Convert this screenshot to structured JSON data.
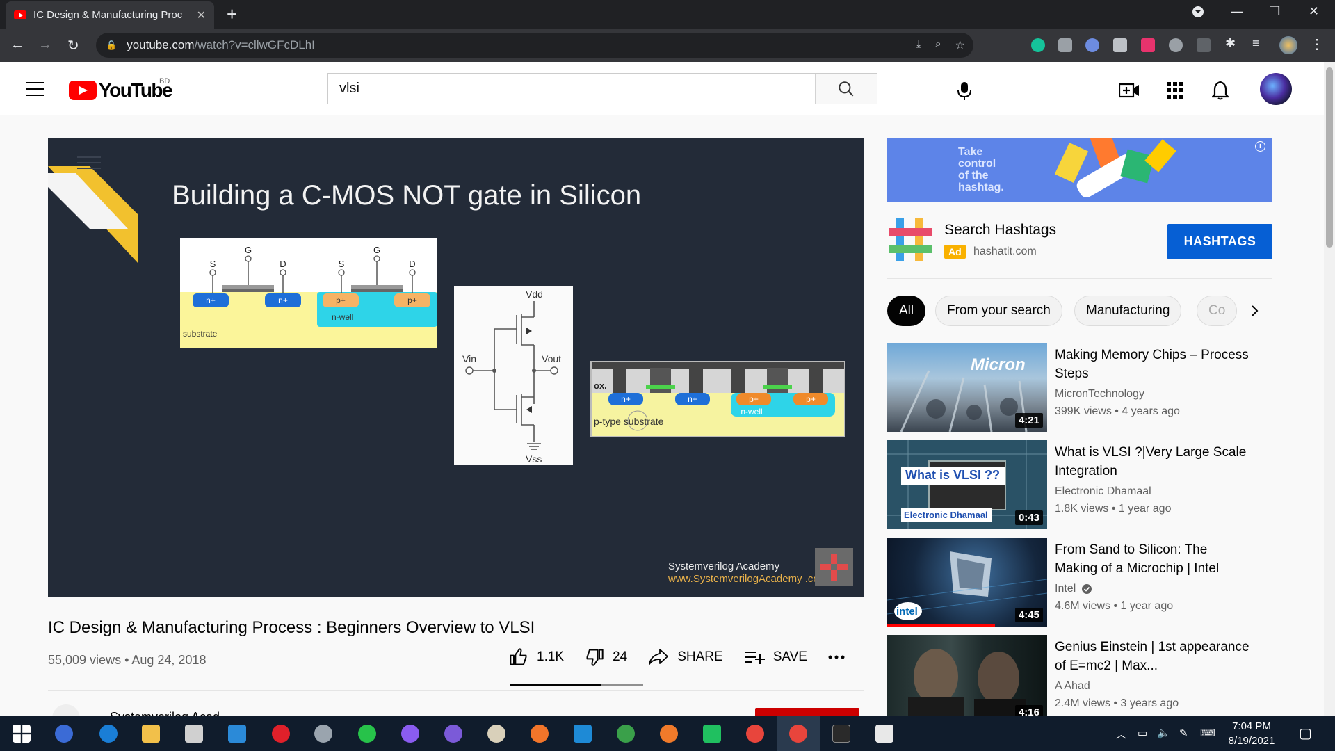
{
  "browser": {
    "tab_title": "IC Design & Manufacturing Proc",
    "url_domain": "youtube.com",
    "url_path": "/watch?v=cllwGFcDLhI"
  },
  "youtube": {
    "country_code": "BD",
    "search_query": "vlsi"
  },
  "video": {
    "slide_title": "Building a C-MOS NOT gate in Silicon",
    "credit_name": "Systemverilog Academy",
    "credit_url": "www.SystemverilogAcademy .com",
    "title": "IC Design & Manufacturing Process : Beginners Overview to VLSI",
    "meta": "55,009 views • Aug 24, 2018",
    "likes": "1.1K",
    "dislikes": "24",
    "share_label": "SHARE",
    "save_label": "SAVE",
    "like_ratio": 0.68,
    "channel_name_partial": "Systemverilog Acad..."
  },
  "diagram": {
    "labels": {
      "s": "S",
      "g": "G",
      "d": "D",
      "n_plus": "n+",
      "p_plus": "p+",
      "n_well": "n-well",
      "substrate": "substrate",
      "vdd": "Vdd",
      "vss": "Vss",
      "vin": "Vin",
      "vout": "Vout",
      "ox": "ox.",
      "p_type_substrate": "p-type substrate"
    }
  },
  "ad": {
    "banner_text_1": "Take",
    "banner_text_2": "control",
    "banner_text_3": "of the",
    "banner_text_4": "hashtag.",
    "name": "Search Hashtags",
    "badge": "Ad",
    "domain": "hashatit.com",
    "cta": "HASHTAGS"
  },
  "chips": [
    "All",
    "From your search",
    "Manufacturing",
    "Co"
  ],
  "recommendations": [
    {
      "title": "Making Memory Chips – Process Steps",
      "channel": "MicronTechnology",
      "meta": "399K views • 4 years ago",
      "duration": "4:21",
      "thumb_text": "Micron",
      "verified": false
    },
    {
      "title": "What is VLSI ?|Very Large Scale Integration",
      "channel": "Electronic Dhamaal",
      "meta": "1.8K views • 1 year ago",
      "duration": "0:43",
      "thumb_text": "What is VLSI ??",
      "thumb_sub": "Electronic Dhamaal",
      "verified": false
    },
    {
      "title": "From Sand to Silicon: The Making of a Microchip | Intel",
      "channel": "Intel",
      "meta": "4.6M views • 1 year ago",
      "duration": "4:45",
      "thumb_text": "intel",
      "verified": true
    },
    {
      "title": "Genius Einstein | 1st appearance of E=mc2 | Max...",
      "channel": "A Ahad",
      "meta": "2.4M views • 3 years ago",
      "duration": "4:16",
      "verified": false
    }
  ],
  "taskbar": {
    "time": "7:04 PM",
    "date": "8/19/2021"
  },
  "colors": {
    "youtube_red": "#ff0000",
    "cta_blue": "#065fd4",
    "chrome_dark": "#202124",
    "taskbar": "#101c2c"
  }
}
